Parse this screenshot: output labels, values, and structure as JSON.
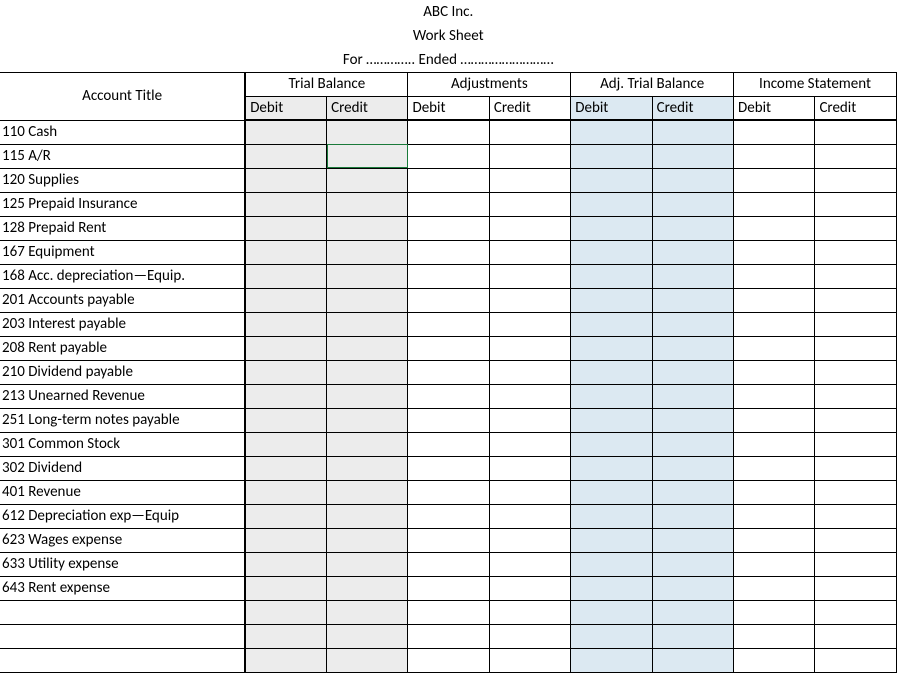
{
  "header": {
    "company": "ABC Inc.",
    "doc_title": "Work Sheet",
    "period_line": "For ………….. Ended ………………………"
  },
  "columns": {
    "account_title": "Account Title",
    "groups": [
      {
        "label": "Trial Balance",
        "debit": "Debit",
        "credit": "Credit",
        "fill": "grey"
      },
      {
        "label": "Adjustments",
        "debit": "Debit",
        "credit": "Credit",
        "fill": "none"
      },
      {
        "label": "Adj. Trial Balance",
        "debit": "Debit",
        "credit": "Credit",
        "fill": "blue"
      },
      {
        "label": "Income Statement",
        "debit": "Debit",
        "credit": "Credit",
        "fill": "none"
      }
    ]
  },
  "rows": [
    {
      "title": "110 Cash"
    },
    {
      "title": "115 A/R"
    },
    {
      "title": "120 Supplies"
    },
    {
      "title": "125 Prepaid Insurance"
    },
    {
      "title": "128 Prepaid Rent"
    },
    {
      "title": "167 Equipment"
    },
    {
      "title": "168 Acc. depreciation—Equip."
    },
    {
      "title": "201 Accounts payable"
    },
    {
      "title": "203 Interest payable"
    },
    {
      "title": "208 Rent payable"
    },
    {
      "title": "210 Dividend payable"
    },
    {
      "title": "213 Unearned Revenue"
    },
    {
      "title": "251 Long-term notes payable"
    },
    {
      "title": "301  Common Stock"
    },
    {
      "title": "302 Dividend"
    },
    {
      "title": "401 Revenue"
    },
    {
      "title": "612 Depreciation exp—Equip"
    },
    {
      "title": "623 Wages expense"
    },
    {
      "title": "633 Utility expense"
    },
    {
      "title": "643 Rent expense"
    },
    {
      "title": ""
    },
    {
      "title": ""
    },
    {
      "title": ""
    }
  ],
  "selection": {
    "row_index": 1,
    "group_index": 0,
    "sub": "credit"
  }
}
